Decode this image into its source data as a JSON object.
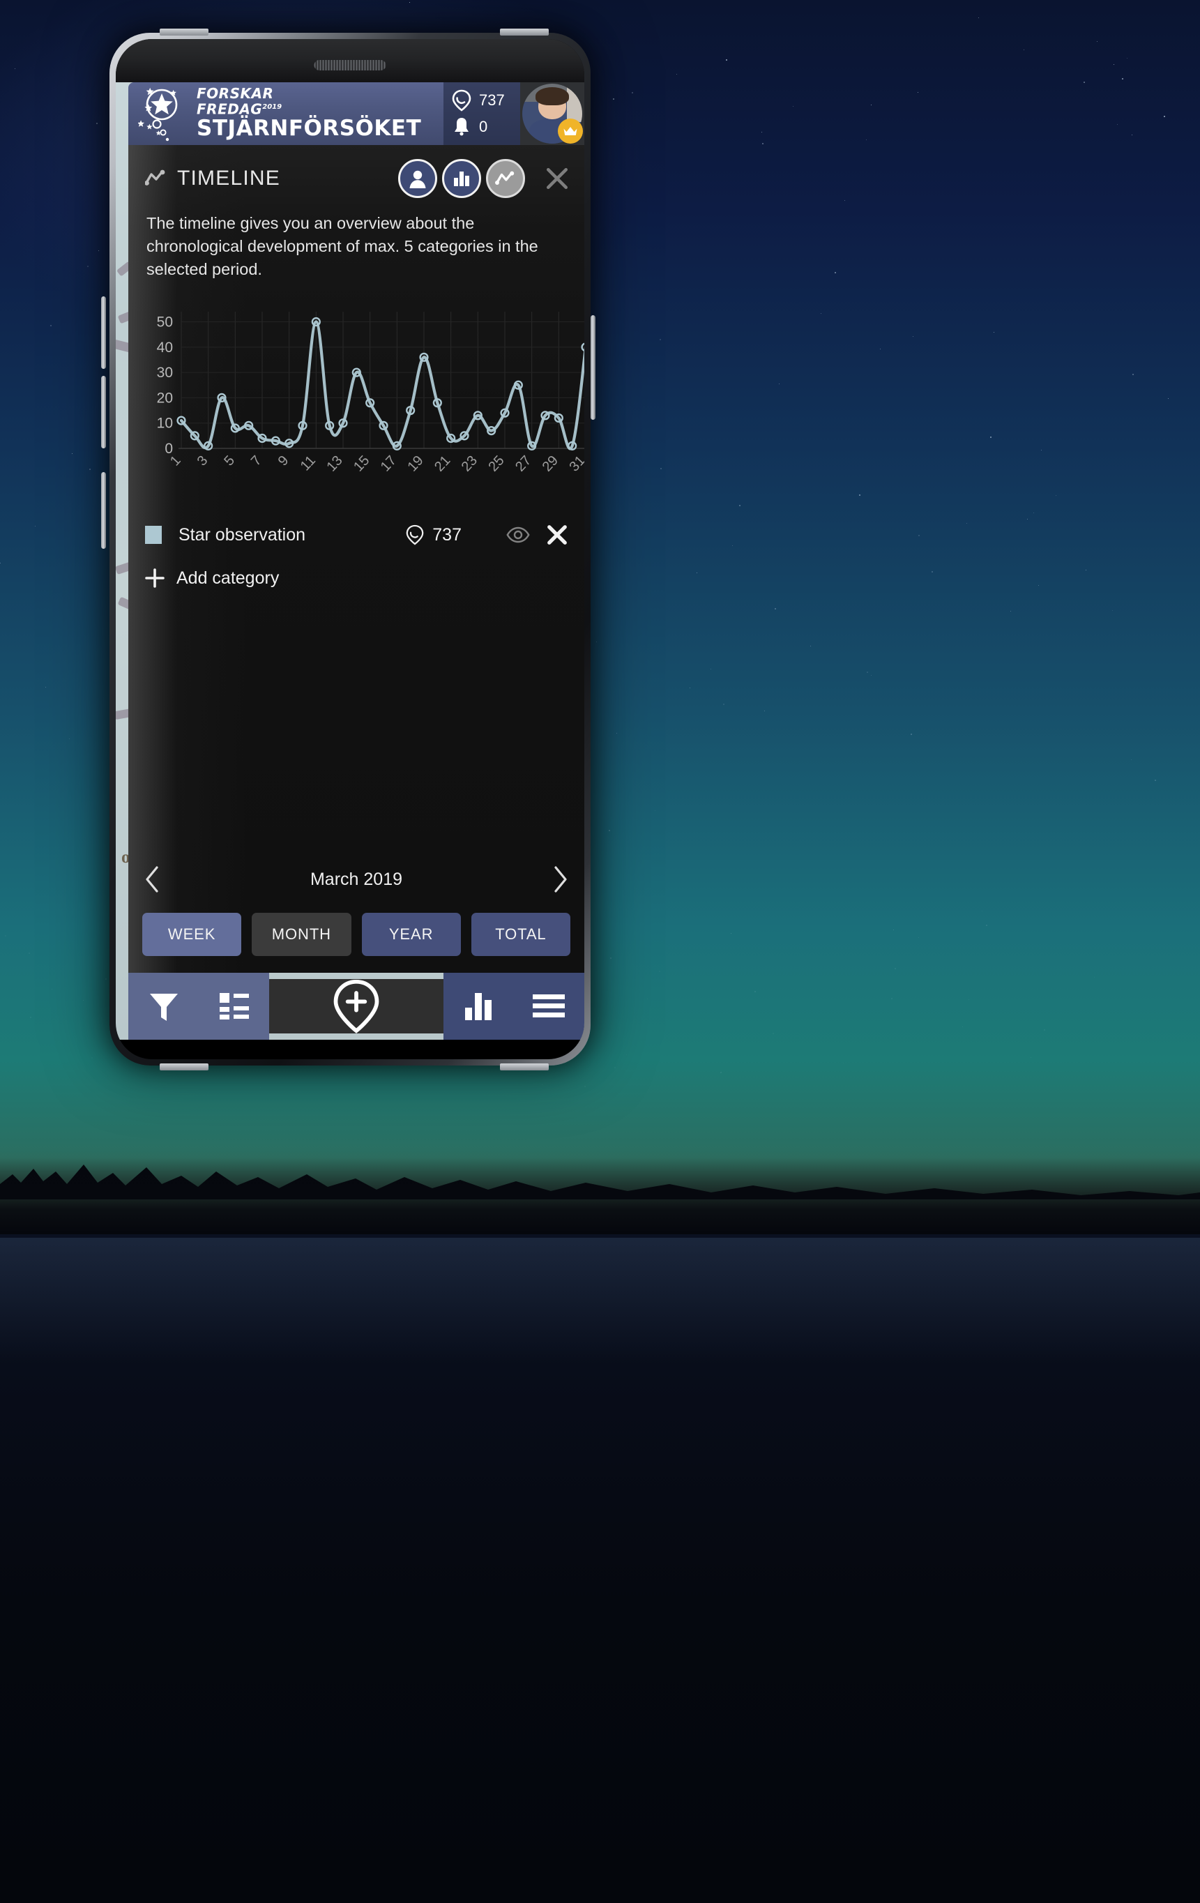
{
  "app": {
    "brand_line1": "FORSKAR",
    "brand_line2": "FREDAG",
    "brand_year": "2019",
    "project_title": "STJÄRNFÖRSÖKET",
    "observation_count": "737",
    "notification_count": "0"
  },
  "panel": {
    "title": "TIMELINE",
    "description": "The timeline gives you an overview about the chronological development of max. 5 categories in the selected period.",
    "view_buttons": [
      {
        "name": "profile-view",
        "icon": "person-icon",
        "state": "inactive"
      },
      {
        "name": "bar-chart-view",
        "icon": "bar-chart-icon",
        "state": "inactive"
      },
      {
        "name": "timeline-view",
        "icon": "line-chart-icon",
        "state": "active"
      }
    ],
    "close_label": "×"
  },
  "legend": {
    "category_name": "Star observation",
    "category_count": "737",
    "swatch_color": "#adc8d2",
    "add_category_label": "Add category"
  },
  "period": {
    "label": "March 2019",
    "prev_label": "‹",
    "next_label": "›",
    "ranges": [
      {
        "label": "WEEK",
        "state": "light"
      },
      {
        "label": "MONTH",
        "state": "active"
      },
      {
        "label": "YEAR",
        "state": "normal"
      },
      {
        "label": "TOTAL",
        "state": "normal"
      }
    ]
  },
  "bottom_nav": [
    {
      "name": "filter-icon",
      "label": "filter"
    },
    {
      "name": "list-grid-icon",
      "label": "list"
    },
    {
      "name": "add-observation-icon",
      "label": "add"
    },
    {
      "name": "statistics-icon",
      "label": "stats"
    },
    {
      "name": "menu-icon",
      "label": "menu"
    }
  ],
  "map_backdrop_text": "orsa",
  "chart_data": {
    "type": "line",
    "title": "",
    "xlabel": "",
    "ylabel": "",
    "ylim": [
      0,
      54
    ],
    "yticks": [
      0,
      10,
      20,
      30,
      40,
      50
    ],
    "xticks": [
      1,
      3,
      5,
      7,
      9,
      11,
      13,
      15,
      17,
      19,
      21,
      23,
      25,
      27,
      29,
      31
    ],
    "grid": true,
    "legend_position": "below",
    "line_color": "#adc8d2",
    "marker": "circle-open",
    "x": [
      1,
      2,
      3,
      4,
      5,
      6,
      7,
      8,
      9,
      10,
      11,
      12,
      13,
      14,
      15,
      16,
      17,
      18,
      19,
      20,
      21,
      22,
      23,
      24,
      25,
      26,
      27,
      28,
      29,
      30,
      31
    ],
    "series": [
      {
        "name": "Star observation",
        "values": [
          11,
          5,
          1,
          20,
          8,
          9,
          4,
          3,
          2,
          9,
          50,
          9,
          10,
          30,
          18,
          9,
          1,
          15,
          36,
          18,
          4,
          5,
          13,
          7,
          14,
          25,
          1,
          13,
          12,
          1,
          40
        ]
      }
    ]
  }
}
